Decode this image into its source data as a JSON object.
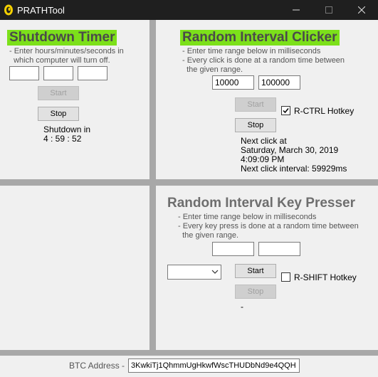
{
  "window": {
    "title": "PRATHTool"
  },
  "shutdown": {
    "title": "Shutdown Timer",
    "desc": "- Enter hours/minutes/seconds in\n  which computer will turn off.",
    "hours": "",
    "minutes": "",
    "seconds": "",
    "start_label": "Start",
    "stop_label": "Stop",
    "status_line1": "Shutdown in",
    "status_line2": "4 : 59 : 52"
  },
  "clicker": {
    "title": "Random Interval Clicker",
    "desc": "- Enter time range below in milliseconds\n- Every click is done at a random time between\n  the given range.",
    "min_ms": "10000",
    "max_ms": "100000",
    "start_label": "Start",
    "stop_label": "Stop",
    "hotkey_label": "R-CTRL Hotkey",
    "hotkey_checked": true,
    "next_click_header": "Next click at",
    "next_click_date": "Saturday, March 30, 2019",
    "next_click_time": "4:09:09 PM",
    "next_click_interval": "Next click interval: 59929ms"
  },
  "keypresser": {
    "title": "Random Interval Key Presser",
    "desc": "- Enter time range below in milliseconds\n- Every key press is done at a random time between\n  the given range.",
    "min_ms": "",
    "max_ms": "",
    "key_selected": "",
    "start_label": "Start",
    "stop_label": "Stop",
    "hotkey_label": "R-SHIFT Hotkey",
    "hotkey_checked": false,
    "status": "-"
  },
  "footer": {
    "btc_label": "BTC Address -",
    "btc_address": "3KwkiTj1QhmmUgHkwfWscTHUDbNd9e4QQH"
  },
  "icons": {
    "app": "app-logo-icon",
    "minimize": "minimize-icon",
    "maximize": "maximize-icon",
    "close": "close-icon"
  },
  "colors": {
    "title_highlight": "#7ce01a",
    "titlebar": "#1f1f1f"
  }
}
